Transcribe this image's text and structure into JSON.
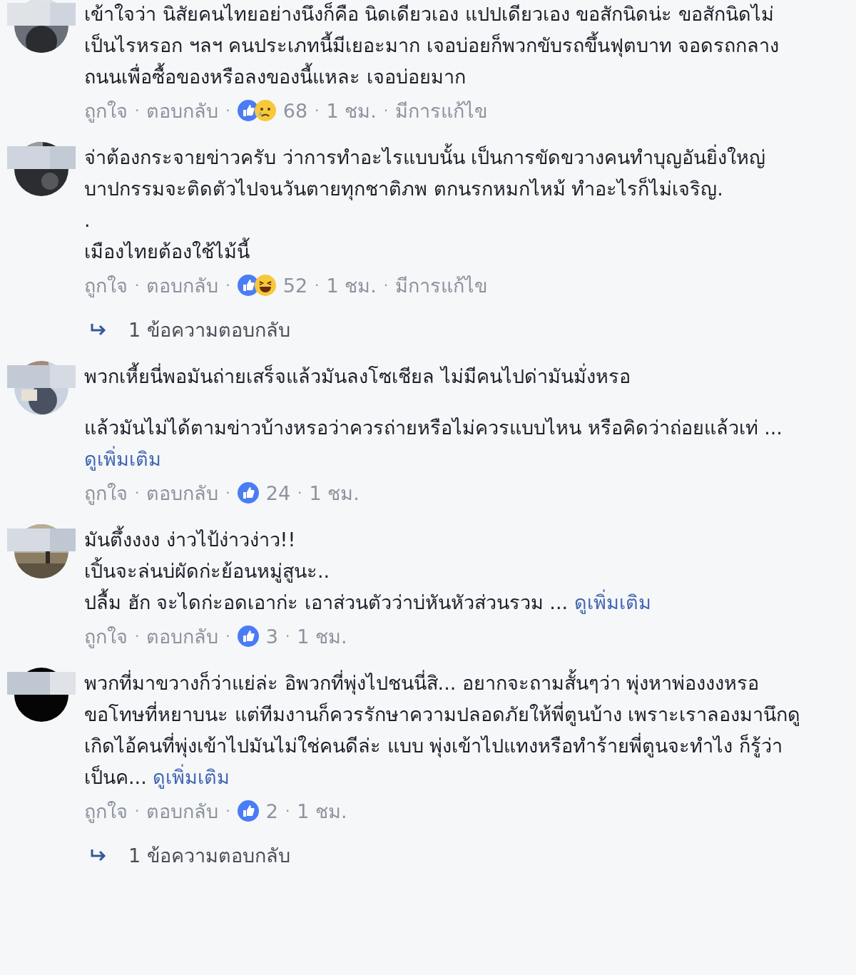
{
  "comments": [
    {
      "avatar": {
        "kind": "picture"
      },
      "paragraphs": [
        {
          "text": "เข้าใจว่า นิสัยคนไทยอย่างนึงก็คือ นิดเดียวเอง แปปเดียวเอง ขอสักนิดน่ะ ขอสักนิดไม่เป็นไรหรอก ฯลฯ คนประเภทนี้มีเยอะมาก เจอบ่อยก็พวกขับรถขึ้นฟุตบาท จอดรถกลางถนนเพื่อซื้อของหรือลงของนี้แหละ เจอบ่อยมาก"
        }
      ],
      "actions": [
        {
          "kind": "link",
          "text": "ถูกใจ"
        },
        {
          "kind": "sep",
          "text": "·"
        },
        {
          "kind": "link",
          "text": "ตอบกลับ"
        },
        {
          "kind": "sep",
          "text": "·"
        },
        {
          "kind": "reactions",
          "icons": [
            {
              "kind": "like"
            },
            {
              "kind": "sad"
            }
          ],
          "text": "68"
        },
        {
          "kind": "sep",
          "text": "·"
        },
        {
          "kind": "time",
          "text": "1 ชม."
        },
        {
          "kind": "sep",
          "text": "·"
        },
        {
          "kind": "link",
          "text": "มีการแก้ไข"
        }
      ]
    },
    {
      "avatar": {
        "kind": "picture"
      },
      "paragraphs": [
        {
          "text": "จ่าต้องกระจายข่าวครับ ว่าการทำอะไรแบบนั้น เป็นการขัดขวางคนทำบุญอันยิ่งใหญ่ บาปกรรมจะติดตัวไปจนวันตายทุกชาติภพ ตกนรกหมกไหม้ ทำอะไรก็ไม่เจริญ."
        },
        {
          "text": "."
        },
        {
          "text": "เมืองไทยต้องใช้ไม้นี้"
        }
      ],
      "actions": [
        {
          "kind": "link",
          "text": "ถูกใจ"
        },
        {
          "kind": "sep",
          "text": "·"
        },
        {
          "kind": "link",
          "text": "ตอบกลับ"
        },
        {
          "kind": "sep",
          "text": "·"
        },
        {
          "kind": "reactions",
          "icons": [
            {
              "kind": "like"
            },
            {
              "kind": "haha"
            }
          ],
          "text": "52"
        },
        {
          "kind": "sep",
          "text": "·"
        },
        {
          "kind": "time",
          "text": "1 ชม."
        },
        {
          "kind": "sep",
          "text": "·"
        },
        {
          "kind": "link",
          "text": "มีการแก้ไข"
        }
      ],
      "replies": "1 ข้อความตอบกลับ"
    },
    {
      "avatar": {
        "kind": "picture"
      },
      "paragraphs": [
        {
          "text": "พวกเหี้ยนี่พอมันถ่ายเสร็จแล้วมันลงโซเชียล ไม่มีคนไปด่ามันมั่งหรอ"
        },
        {
          "text": "แล้วมันไม่ได้ตามข่าวบ้างหรอว่าควรถ่ายหรือไม่ควรแบบไหน หรือคิดว่าถ่อยแล้วเท่ ...",
          "spaced": true
        }
      ],
      "see_more": "ดูเพิ่มเติม",
      "actions": [
        {
          "kind": "link",
          "text": "ถูกใจ"
        },
        {
          "kind": "sep",
          "text": "·"
        },
        {
          "kind": "link",
          "text": "ตอบกลับ"
        },
        {
          "kind": "sep",
          "text": "·"
        },
        {
          "kind": "reactions",
          "icons": [
            {
              "kind": "like"
            }
          ],
          "text": "24"
        },
        {
          "kind": "sep",
          "text": "·"
        },
        {
          "kind": "time",
          "text": "1 ชม."
        }
      ]
    },
    {
      "avatar": {
        "kind": "picture"
      },
      "paragraphs": [
        {
          "text": "มันตึ้งงงง ง่าวไป้ง่าวง่าว!!"
        },
        {
          "text": "เปิ้นจะล่นบ่ผัดก่ะย้อนหมู่สูนะ.."
        },
        {
          "text": "ปลื้ม ฮัก จะไดก่ะอดเอาก่ะ เอาส่วนตัวว่าบ่หันหัวส่วนรวม ..."
        }
      ],
      "see_more": "ดูเพิ่มเติม",
      "actions": [
        {
          "kind": "link",
          "text": "ถูกใจ"
        },
        {
          "kind": "sep",
          "text": "·"
        },
        {
          "kind": "link",
          "text": "ตอบกลับ"
        },
        {
          "kind": "sep",
          "text": "·"
        },
        {
          "kind": "reactions",
          "icons": [
            {
              "kind": "like"
            }
          ],
          "text": "3"
        },
        {
          "kind": "sep",
          "text": "·"
        },
        {
          "kind": "time",
          "text": "1 ชม."
        }
      ]
    },
    {
      "avatar": {
        "kind": "picture"
      },
      "paragraphs": [
        {
          "text": "พวกที่มาขวางก็ว่าแย่ล่ะ อิพวกที่พุ่งไปชนนี่สิ... อยากจะถามสั้นๆว่า พุ่งหาพ่องงงหรอ ขอโทษที่หยาบนะ แต่ทีมงานก็ควรรักษาความปลอดภัยให้พี่ตูนบ้าง เพราะเราลองมานึกดู เกิดไอ้คนที่พุ่งเข้าไปมันไม่ใช่คนดีล่ะ แบบ พุ่งเข้าไปแทงหรือทำร้ายพี่ตูนจะทำไง ก็รู้ว่าเป็นค..."
        }
      ],
      "see_more": "ดูเพิ่มเติม",
      "actions": [
        {
          "kind": "link",
          "text": "ถูกใจ"
        },
        {
          "kind": "sep",
          "text": "·"
        },
        {
          "kind": "link",
          "text": "ตอบกลับ"
        },
        {
          "kind": "sep",
          "text": "·"
        },
        {
          "kind": "reactions",
          "icons": [
            {
              "kind": "like"
            }
          ],
          "text": "2"
        },
        {
          "kind": "sep",
          "text": "·"
        },
        {
          "kind": "time",
          "text": "1 ชม."
        }
      ],
      "replies": "1 ข้อความตอบกลับ"
    }
  ]
}
